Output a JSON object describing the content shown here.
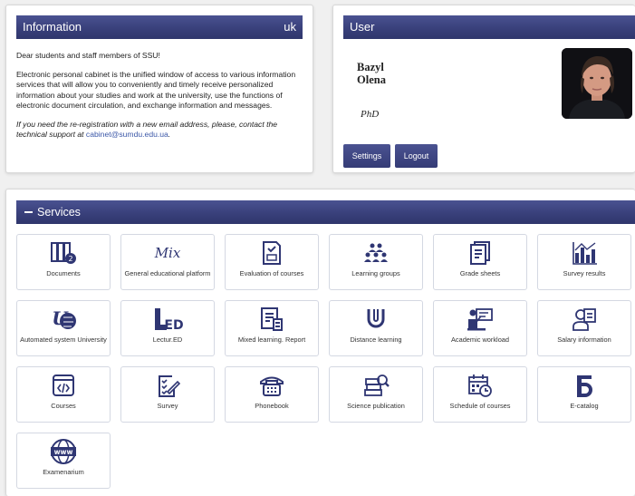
{
  "info": {
    "title": "Information",
    "lang": "uk",
    "p1": "Dear students and staff members of SSU!",
    "p2": "Electronic personal cabinet is the unified window of access to various information services that will allow you to conveniently and timely receive personalized information about your studies and work at the university, use the functions of electronic document circulation, and exchange information and messages.",
    "p3_text": "If you need the re-registration with a new email address, please, contact the technical support at ",
    "p3_email": "cabinet@sumdu.edu.ua",
    "p3_end": "."
  },
  "user": {
    "title": "User",
    "surname": "Bazyl",
    "given": "Olena",
    "degree": "PhD",
    "settings_label": "Settings",
    "logout_label": "Logout"
  },
  "services": {
    "title": "Services",
    "items": [
      {
        "label": "Documents",
        "icon": "documents-icon"
      },
      {
        "label": "General educational platform",
        "icon": "mix-logo-icon"
      },
      {
        "label": "Evaluation of courses",
        "icon": "evaluation-icon"
      },
      {
        "label": "Learning groups",
        "icon": "group-icon"
      },
      {
        "label": "Grade sheets",
        "icon": "grade-sheet-icon"
      },
      {
        "label": "Survey results",
        "icon": "bar-chart-icon"
      },
      {
        "label": "Automated system University",
        "icon": "university-logo-icon"
      },
      {
        "label": "Lectur.ED",
        "icon": "lectured-logo-icon"
      },
      {
        "label": "Mixed learning. Report",
        "icon": "report-icon"
      },
      {
        "label": "Distance learning",
        "icon": "distance-learning-icon"
      },
      {
        "label": "Academic workload",
        "icon": "teacher-board-icon"
      },
      {
        "label": "Salary information",
        "icon": "salary-icon"
      },
      {
        "label": "Courses",
        "icon": "code-window-icon"
      },
      {
        "label": "Survey",
        "icon": "checklist-icon"
      },
      {
        "label": "Phonebook",
        "icon": "phone-icon"
      },
      {
        "label": "Science publication",
        "icon": "books-search-icon"
      },
      {
        "label": "Schedule of courses",
        "icon": "calendar-clock-icon"
      },
      {
        "label": "E-catalog",
        "icon": "e-catalog-icon"
      },
      {
        "label": "Examenarium",
        "icon": "www-globe-icon"
      }
    ]
  },
  "colors": {
    "header": "#39407b",
    "icon": "#2f3673",
    "link": "#3c58a8"
  }
}
